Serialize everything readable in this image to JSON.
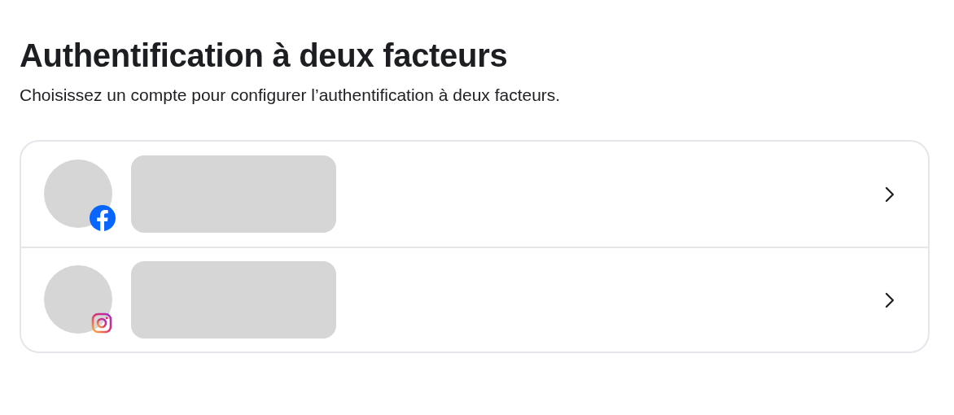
{
  "title": "Authentification à deux facteurs",
  "subtitle": "Choisissez un compte pour configurer l’authentification à deux facteurs.",
  "accounts": [
    {
      "kind": "facebook"
    },
    {
      "kind": "instagram"
    }
  ]
}
